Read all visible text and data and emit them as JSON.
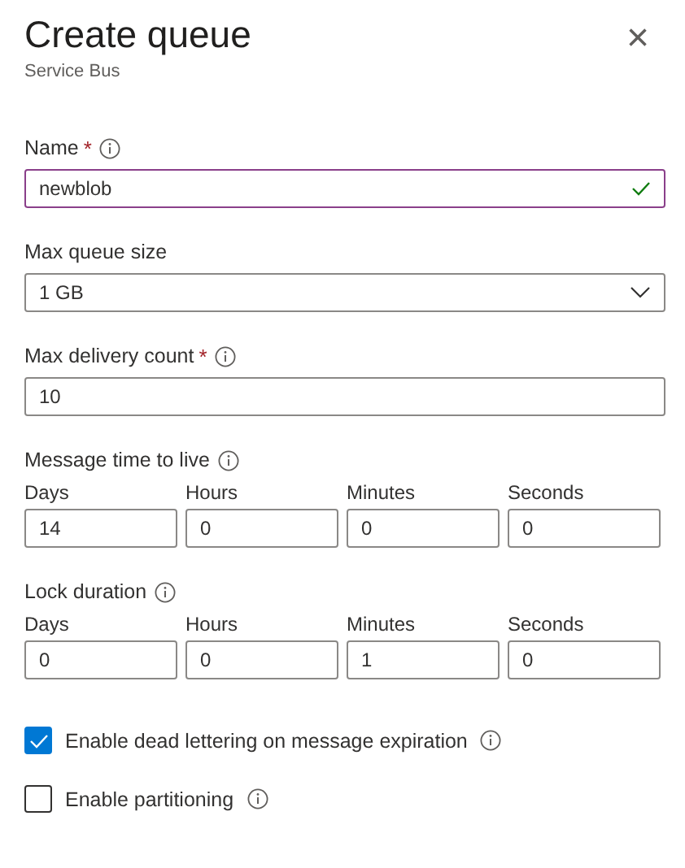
{
  "header": {
    "title": "Create queue",
    "subtitle": "Service Bus",
    "close": "×"
  },
  "fields": [
    {
      "kind": "text",
      "label": "Name",
      "required_mark": "*",
      "info": true,
      "value": "newblob",
      "valid": true
    },
    {
      "kind": "select",
      "label": "Max queue size",
      "info": false,
      "value": "1 GB"
    },
    {
      "kind": "text",
      "label": "Max delivery count",
      "required_mark": "*",
      "info": true,
      "value": "10",
      "valid": false
    },
    {
      "kind": "duration",
      "label": "Message time to live",
      "info": true,
      "parts": [
        {
          "label": "Days",
          "value": "14"
        },
        {
          "label": "Hours",
          "value": "0"
        },
        {
          "label": "Minutes",
          "value": "0"
        },
        {
          "label": "Seconds",
          "value": "0"
        }
      ]
    },
    {
      "kind": "duration",
      "label": "Lock duration",
      "info": true,
      "parts": [
        {
          "label": "Days",
          "value": "0"
        },
        {
          "label": "Hours",
          "value": "0"
        },
        {
          "label": "Minutes",
          "value": "1"
        },
        {
          "label": "Seconds",
          "value": "0"
        }
      ]
    },
    {
      "kind": "checkbox",
      "label": "Enable dead lettering on message expiration",
      "info": true,
      "checked": true
    },
    {
      "kind": "checkbox",
      "label": "Enable partitioning",
      "info": true,
      "checked": false
    }
  ]
}
